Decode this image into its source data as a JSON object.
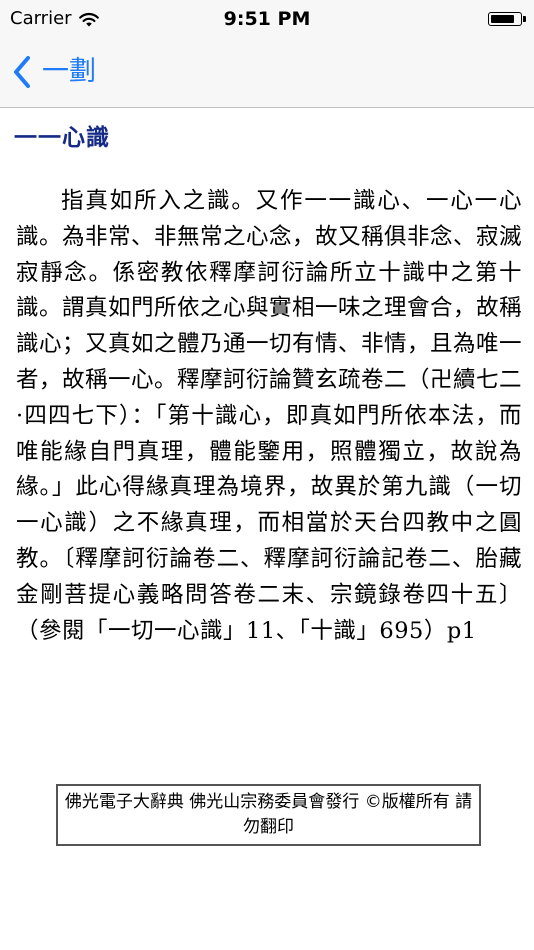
{
  "status_bar": {
    "carrier": "Carrier",
    "time": "9:51 PM",
    "wifi_icon": "wifi-icon",
    "battery_icon": "battery-icon",
    "battery_level": 0.85
  },
  "nav": {
    "back_label": "一劃",
    "back_icon": "chevron-left-icon",
    "accent_color": "#1f7bf6"
  },
  "entry": {
    "title": "一一心識",
    "title_color": "#152a86",
    "body": "指真如所入之識。又作一一識心、一心一心識。為非常、非無常之心念，故又稱俱非念、寂滅寂靜念。係密教依釋摩訶衍論所立十識中之第十識。謂真如門所依之心與實相一味之理會合，故稱識心；又真如之體乃通一切有情、非情，且為唯一者，故稱一心。釋摩訶衍論贊玄疏卷二（卍續七二·四四七下）：「第十識心，即真如門所依本法，而唯能緣自門真理，體能鑒用，照體獨立，故說為緣。」此心得緣真理為境界，故異於第九識（一切一心識）之不緣真理，而相當於天台四教中之圓教。〔釋摩訶衍論卷二、釋摩訶衍論記卷二、胎藏金剛菩提心義略問答卷二末、宗鏡錄卷四十五〕（參閱「一切一心識」11、「十識」695）p1"
  },
  "footer": {
    "copyright": "佛光電子大辭典  佛光山宗務委員會發行 ©版權所有  請勿翻印"
  }
}
